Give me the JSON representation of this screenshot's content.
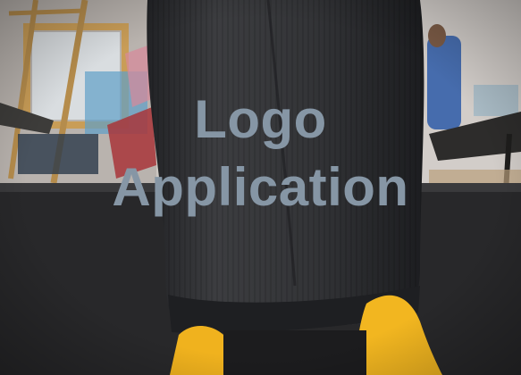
{
  "overlay": {
    "line1": "Logo",
    "line2": "Application",
    "text_color": "#8696a5"
  },
  "scene": {
    "subject": "dark corduroy trouser leg",
    "colors": {
      "wall": "#cfcac6",
      "floor_dark": "#2a2a2c",
      "pants": "#38393c",
      "pants_shadow": "#1f2022",
      "shoe": "#f0b21e",
      "frame_wood": "#c79a55",
      "table": "#3b3a38",
      "blue_jacket": "#2e5aa8"
    }
  }
}
